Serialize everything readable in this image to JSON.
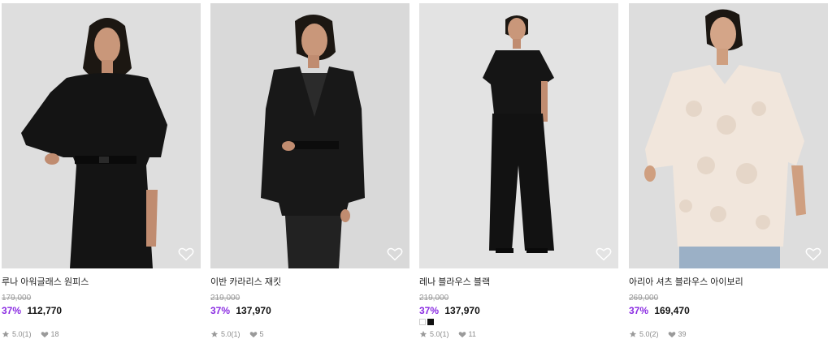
{
  "products": [
    {
      "name": "루나 아워글래스 원피스",
      "original_price": "179,000",
      "discount": "37%",
      "price": "112,770",
      "rating": "5.0(1)",
      "likes": "18",
      "bg_color": "#dedede",
      "garment_color": "#141414",
      "swatches": []
    },
    {
      "name": "이반 카라리스 재킷",
      "original_price": "219,000",
      "discount": "37%",
      "price": "137,970",
      "rating": "5.0(1)",
      "likes": "5",
      "bg_color": "#d9d9d9",
      "garment_color": "#181818",
      "swatches": []
    },
    {
      "name": "레나 블라우스 블랙",
      "original_price": "219,000",
      "discount": "37%",
      "price": "137,970",
      "rating": "5.0(1)",
      "likes": "11",
      "bg_color": "#e3e3e3",
      "garment_color": "#151515",
      "swatches": [
        "#ffffff",
        "#111111"
      ]
    },
    {
      "name": "아리아 셔츠 블라우스 아이보리",
      "original_price": "269,000",
      "discount": "37%",
      "price": "169,470",
      "rating": "5.0(2)",
      "likes": "39",
      "bg_color": "#dddddd",
      "garment_color": "#f1e6dc",
      "swatches": []
    }
  ],
  "colors": {
    "discount": "#8a2be2",
    "meta": "#8c8c8c"
  }
}
